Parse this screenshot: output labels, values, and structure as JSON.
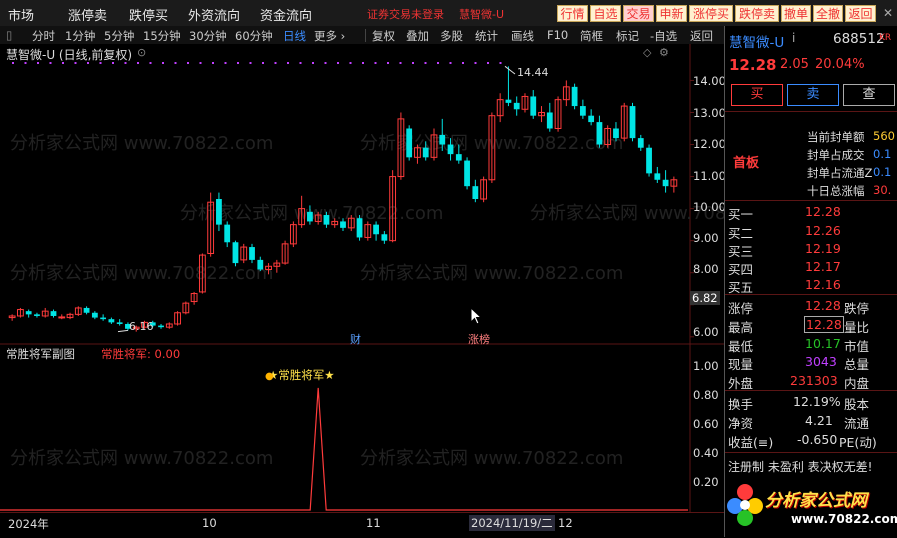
{
  "top_menu": [
    "市场",
    "涨停卖",
    "跌停买",
    "外资流向",
    "资金流向"
  ],
  "status_text": "证券交易未登录",
  "stock_short": "慧智微-U",
  "top_buttons": [
    "行情",
    "自选",
    "交易",
    "申新",
    "涨停买",
    "跌停卖",
    "撤单",
    "全撤",
    "返回"
  ],
  "periods": [
    "分时",
    "1分钟",
    "5分钟",
    "15分钟",
    "30分钟",
    "60分钟",
    "日线",
    "更多 ›"
  ],
  "active_period": "日线",
  "tools": [
    "复权",
    "叠加",
    "多股",
    "统计",
    "画线",
    "F10",
    "简框",
    "标记",
    "-自选",
    "返回"
  ],
  "chart_title": "慧智微-U (日线,前复权)",
  "sub_title": "常胜将军副图",
  "sub_value_label": "常胜将军: 0.00",
  "sub_signal_label": "★常胜将军★",
  "markers": {
    "cai": "财",
    "zhangbang": "涨榜"
  },
  "max_label": "14.44",
  "min_label": "6.16",
  "watermark": "分析家公式网 www.70822.com",
  "x_labels": [
    "2024年",
    "10",
    "11",
    "12"
  ],
  "cursor_date": "2024/11/19/二",
  "panel": {
    "name": "慧智微-U",
    "name_suffix": "i",
    "code": "688512",
    "badge": "KR",
    "price": "12.28",
    "change": "2.05",
    "pct": "20.04%",
    "buy_btn": "买",
    "sell_btn": "卖",
    "query_btn": "查",
    "limit_tag": "首板",
    "limit_info": [
      {
        "label": "当前封单额",
        "value": "560"
      },
      {
        "label": "封单占成交",
        "value": "0.1"
      },
      {
        "label": "封单占流通Z",
        "value": "0.1"
      },
      {
        "label": "十日总涨幅",
        "value": "30."
      }
    ],
    "bids": [
      {
        "label": "买一",
        "price": "12.28"
      },
      {
        "label": "买二",
        "price": "12.26"
      },
      {
        "label": "买三",
        "price": "12.19"
      },
      {
        "label": "买四",
        "price": "12.17"
      },
      {
        "label": "买五",
        "price": "12.16"
      }
    ],
    "stats": [
      {
        "l1": "涨停",
        "v1": "12.28",
        "l2": "跌停"
      },
      {
        "l1": "最高",
        "v1": "12.28",
        "l2": "量比"
      },
      {
        "l1": "最低",
        "v1": "10.17",
        "l2": "市值"
      },
      {
        "l1": "现量",
        "v1": "3043",
        "l2": "总量"
      },
      {
        "l1": "外盘",
        "v1": "231303",
        "l2": "内盘"
      }
    ],
    "finance": [
      {
        "l1": "换手",
        "v1": "12.19%",
        "l2": "股本"
      },
      {
        "l1": "净资",
        "v1": "4.21",
        "l2": "流通"
      },
      {
        "l1": "收益(≡)",
        "v1": "-0.650",
        "l2": "PE(动)"
      }
    ],
    "footer_note": "注册制 未盈利 表决权无差!",
    "logo_text": "分析家公式网",
    "logo_url": "www.70822.com"
  },
  "price_axis": [
    "14.00",
    "13.00",
    "12.00",
    "11.00",
    "10.00",
    "9.00",
    "8.00",
    "7.00",
    "6.00"
  ],
  "price_tag": "6.82",
  "sub_axis": [
    "1.00",
    "0.80",
    "0.60",
    "0.40",
    "0.20"
  ],
  "chart_data": {
    "type": "candlestick",
    "candles": [
      [
        6.6,
        6.7,
        6.5,
        6.65
      ],
      [
        6.65,
        6.9,
        6.6,
        6.85
      ],
      [
        6.8,
        6.85,
        6.6,
        6.7
      ],
      [
        6.7,
        6.75,
        6.6,
        6.65
      ],
      [
        6.65,
        6.9,
        6.6,
        6.8
      ],
      [
        6.8,
        6.85,
        6.6,
        6.65
      ],
      [
        6.6,
        6.7,
        6.55,
        6.62
      ],
      [
        6.6,
        6.75,
        6.55,
        6.7
      ],
      [
        6.7,
        6.95,
        6.65,
        6.9
      ],
      [
        6.9,
        6.95,
        6.7,
        6.75
      ],
      [
        6.75,
        6.8,
        6.55,
        6.6
      ],
      [
        6.6,
        6.7,
        6.5,
        6.55
      ],
      [
        6.55,
        6.6,
        6.4,
        6.45
      ],
      [
        6.45,
        6.55,
        6.35,
        6.4
      ],
      [
        6.4,
        6.45,
        6.2,
        6.25
      ],
      [
        6.25,
        6.35,
        6.16,
        6.3
      ],
      [
        6.3,
        6.5,
        6.25,
        6.45
      ],
      [
        6.45,
        6.5,
        6.3,
        6.35
      ],
      [
        6.35,
        6.4,
        6.25,
        6.3
      ],
      [
        6.3,
        6.45,
        6.25,
        6.4
      ],
      [
        6.4,
        6.8,
        6.35,
        6.75
      ],
      [
        6.75,
        7.1,
        6.7,
        7.05
      ],
      [
        7.1,
        7.4,
        7.0,
        7.35
      ],
      [
        7.4,
        8.6,
        7.35,
        8.55
      ],
      [
        8.6,
        10.5,
        8.5,
        10.2
      ],
      [
        10.3,
        10.5,
        9.3,
        9.5
      ],
      [
        9.5,
        9.6,
        8.8,
        8.95
      ],
      [
        8.95,
        9.0,
        8.2,
        8.3
      ],
      [
        8.4,
        8.9,
        8.3,
        8.8
      ],
      [
        8.8,
        8.9,
        8.3,
        8.4
      ],
      [
        8.4,
        8.5,
        8.05,
        8.1
      ],
      [
        8.1,
        8.3,
        7.95,
        8.2
      ],
      [
        8.2,
        8.4,
        8.0,
        8.3
      ],
      [
        8.3,
        9.0,
        8.25,
        8.9
      ],
      [
        8.9,
        9.6,
        8.8,
        9.5
      ],
      [
        9.5,
        10.4,
        9.4,
        10.0
      ],
      [
        9.9,
        10.1,
        9.5,
        9.6
      ],
      [
        9.6,
        9.9,
        9.5,
        9.8
      ],
      [
        9.8,
        9.9,
        9.4,
        9.5
      ],
      [
        9.5,
        9.7,
        9.4,
        9.6
      ],
      [
        9.6,
        9.7,
        9.3,
        9.4
      ],
      [
        9.4,
        9.8,
        9.3,
        9.7
      ],
      [
        9.7,
        9.8,
        9.0,
        9.1
      ],
      [
        9.1,
        9.6,
        9.0,
        9.5
      ],
      [
        9.5,
        9.6,
        9.0,
        9.2
      ],
      [
        9.2,
        9.3,
        8.9,
        9.0
      ],
      [
        9.0,
        11.2,
        8.95,
        11.0
      ],
      [
        11.0,
        13.0,
        10.9,
        12.8
      ],
      [
        12.5,
        12.6,
        11.5,
        11.6
      ],
      [
        11.6,
        12.0,
        11.4,
        11.9
      ],
      [
        11.9,
        12.1,
        11.5,
        11.6
      ],
      [
        11.6,
        12.5,
        11.5,
        12.3
      ],
      [
        12.3,
        12.8,
        11.8,
        12.0
      ],
      [
        12.0,
        12.2,
        11.5,
        11.7
      ],
      [
        11.7,
        12.0,
        11.4,
        11.5
      ],
      [
        11.5,
        11.6,
        10.6,
        10.7
      ],
      [
        10.7,
        10.9,
        10.2,
        10.3
      ],
      [
        10.3,
        11.0,
        10.2,
        10.9
      ],
      [
        10.9,
        13.0,
        10.8,
        12.9
      ],
      [
        12.9,
        13.6,
        12.7,
        13.4
      ],
      [
        13.4,
        14.44,
        13.2,
        13.3
      ],
      [
        13.3,
        13.5,
        12.9,
        13.1
      ],
      [
        13.1,
        13.6,
        13.0,
        13.5
      ],
      [
        13.5,
        13.7,
        12.8,
        12.9
      ],
      [
        12.9,
        13.2,
        12.7,
        13.0
      ],
      [
        13.0,
        13.3,
        12.4,
        12.5
      ],
      [
        12.5,
        13.5,
        12.4,
        13.4
      ],
      [
        13.4,
        14.0,
        13.2,
        13.8
      ],
      [
        13.8,
        13.9,
        13.1,
        13.2
      ],
      [
        13.2,
        13.4,
        12.8,
        12.9
      ],
      [
        12.9,
        13.1,
        12.6,
        12.7
      ],
      [
        12.7,
        12.9,
        11.9,
        12.0
      ],
      [
        12.0,
        12.6,
        11.9,
        12.5
      ],
      [
        12.5,
        12.7,
        12.1,
        12.2
      ],
      [
        12.2,
        13.3,
        12.1,
        13.2
      ],
      [
        13.2,
        13.3,
        12.1,
        12.2
      ],
      [
        12.2,
        12.3,
        11.8,
        11.9
      ],
      [
        11.9,
        12.0,
        11.0,
        11.1
      ],
      [
        11.1,
        11.3,
        10.8,
        10.9
      ],
      [
        10.9,
        11.2,
        10.5,
        10.7
      ],
      [
        10.7,
        11.0,
        10.5,
        10.9
      ]
    ],
    "ylim": [
      5.9,
      14.7
    ],
    "sub_series": {
      "name": "常胜将军",
      "peak_index": 37,
      "peak_value": 0.92
    },
    "sub_ylim": [
      0,
      1.1
    ]
  },
  "colors": {
    "up": "#ff3b3b",
    "down": "#00e5e5",
    "accent": "#3b8cff",
    "bg": "#000000"
  }
}
